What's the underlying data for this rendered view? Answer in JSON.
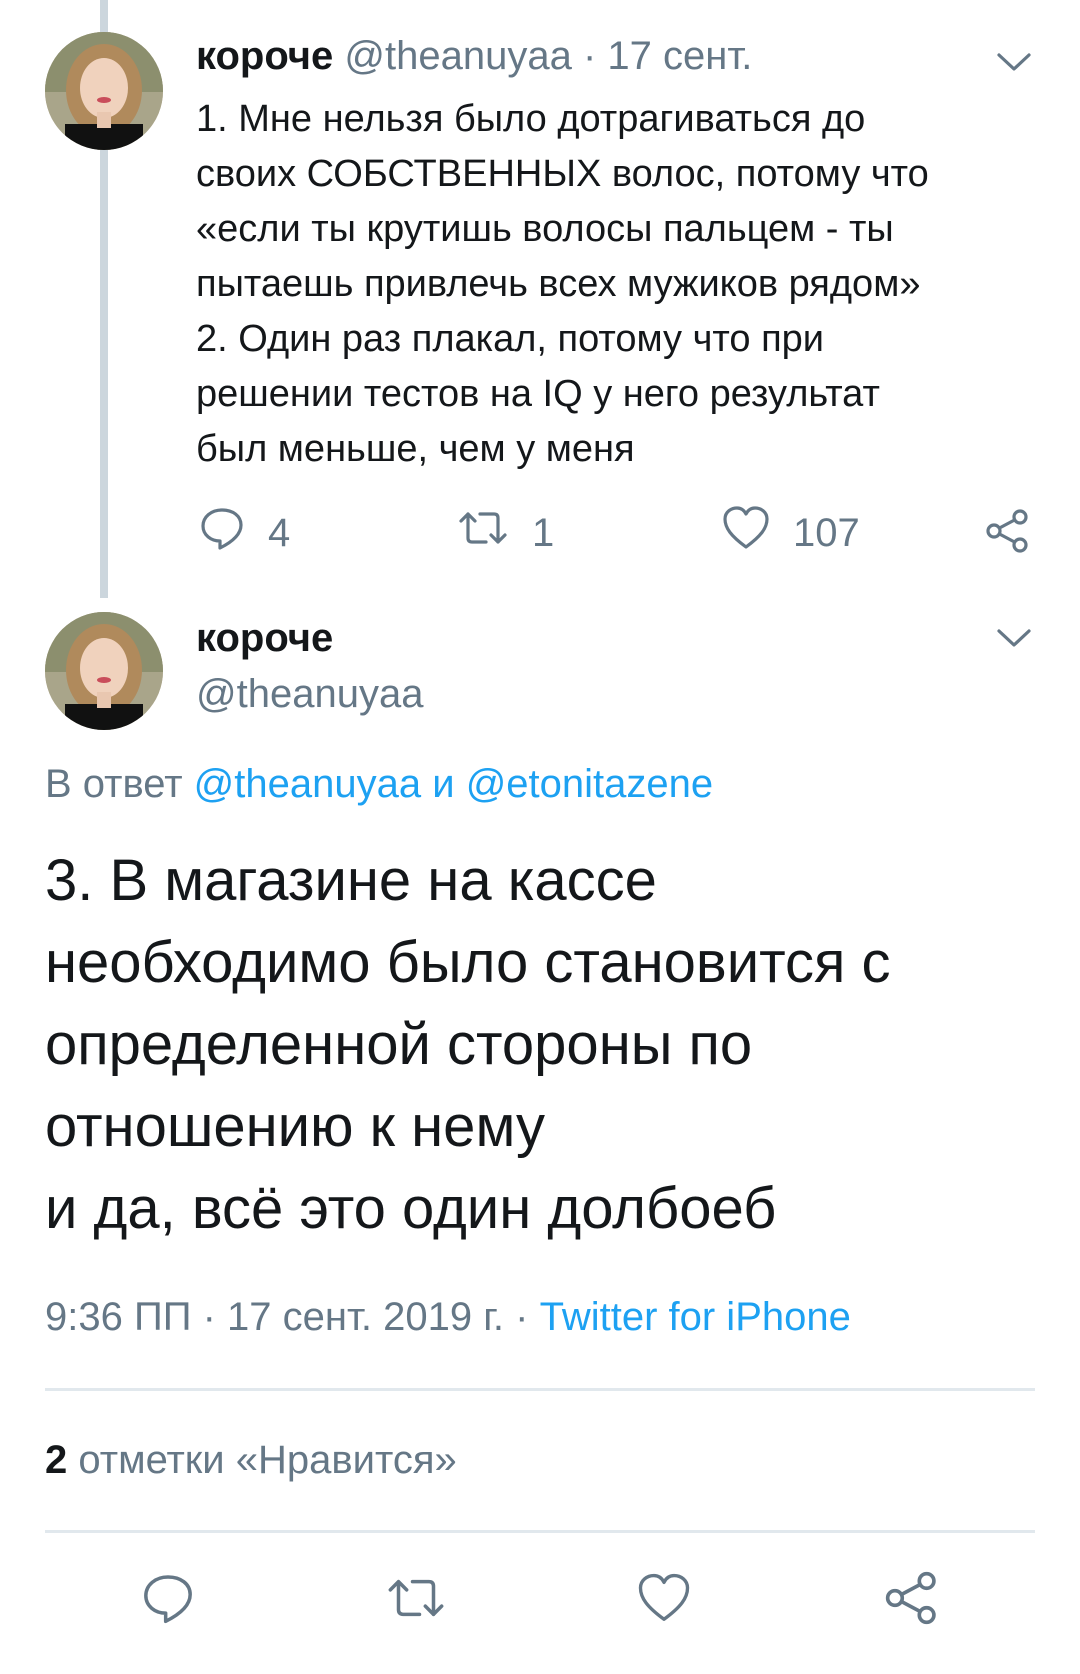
{
  "tweet1": {
    "name": "короче",
    "handle": "@theanuyaa",
    "separator": "·",
    "date": "17 сент.",
    "text_lines": [
      "1. Мне нельзя было дотрагиваться до",
      "своих СОБСТВЕННЫХ волос, потому что",
      "«если ты крутишь волосы пальцем - ты",
      "пытаешь привлечь всех мужиков рядом»",
      "2. Один раз плакал, потому что при",
      "решении тестов на IQ у него результат",
      "был меньше,  чем у меня"
    ],
    "actions": {
      "reply_count": "4",
      "retweet_count": "1",
      "like_count": "107"
    }
  },
  "tweet2": {
    "name": "короче",
    "handle": "@theanuyaa",
    "reply_prefix": "В ответ",
    "reply_user1": "@theanuyaa",
    "reply_and": "и",
    "reply_user2": "@etonitazene",
    "text_lines": [
      "3. В магазине на кассе",
      "необходимо было становится с",
      "определенной стороны по",
      "отношению к нему",
      "и да, всё это один долбоеб"
    ],
    "time": "9:36 ПП",
    "sep1": "·",
    "date": "17 сент. 2019 г.",
    "sep2": "·",
    "source": "Twitter for iPhone",
    "likes_count": "2",
    "likes_label": "отметки «Нравится»"
  },
  "colors": {
    "text": "#14171a",
    "secondary": "#657786",
    "link": "#1da1f2",
    "divider": "#e1e8ed",
    "thread_line": "#ccd6dd"
  },
  "icons": [
    "chevron-down-icon",
    "reply-icon",
    "retweet-icon",
    "like-icon",
    "share-icon"
  ]
}
